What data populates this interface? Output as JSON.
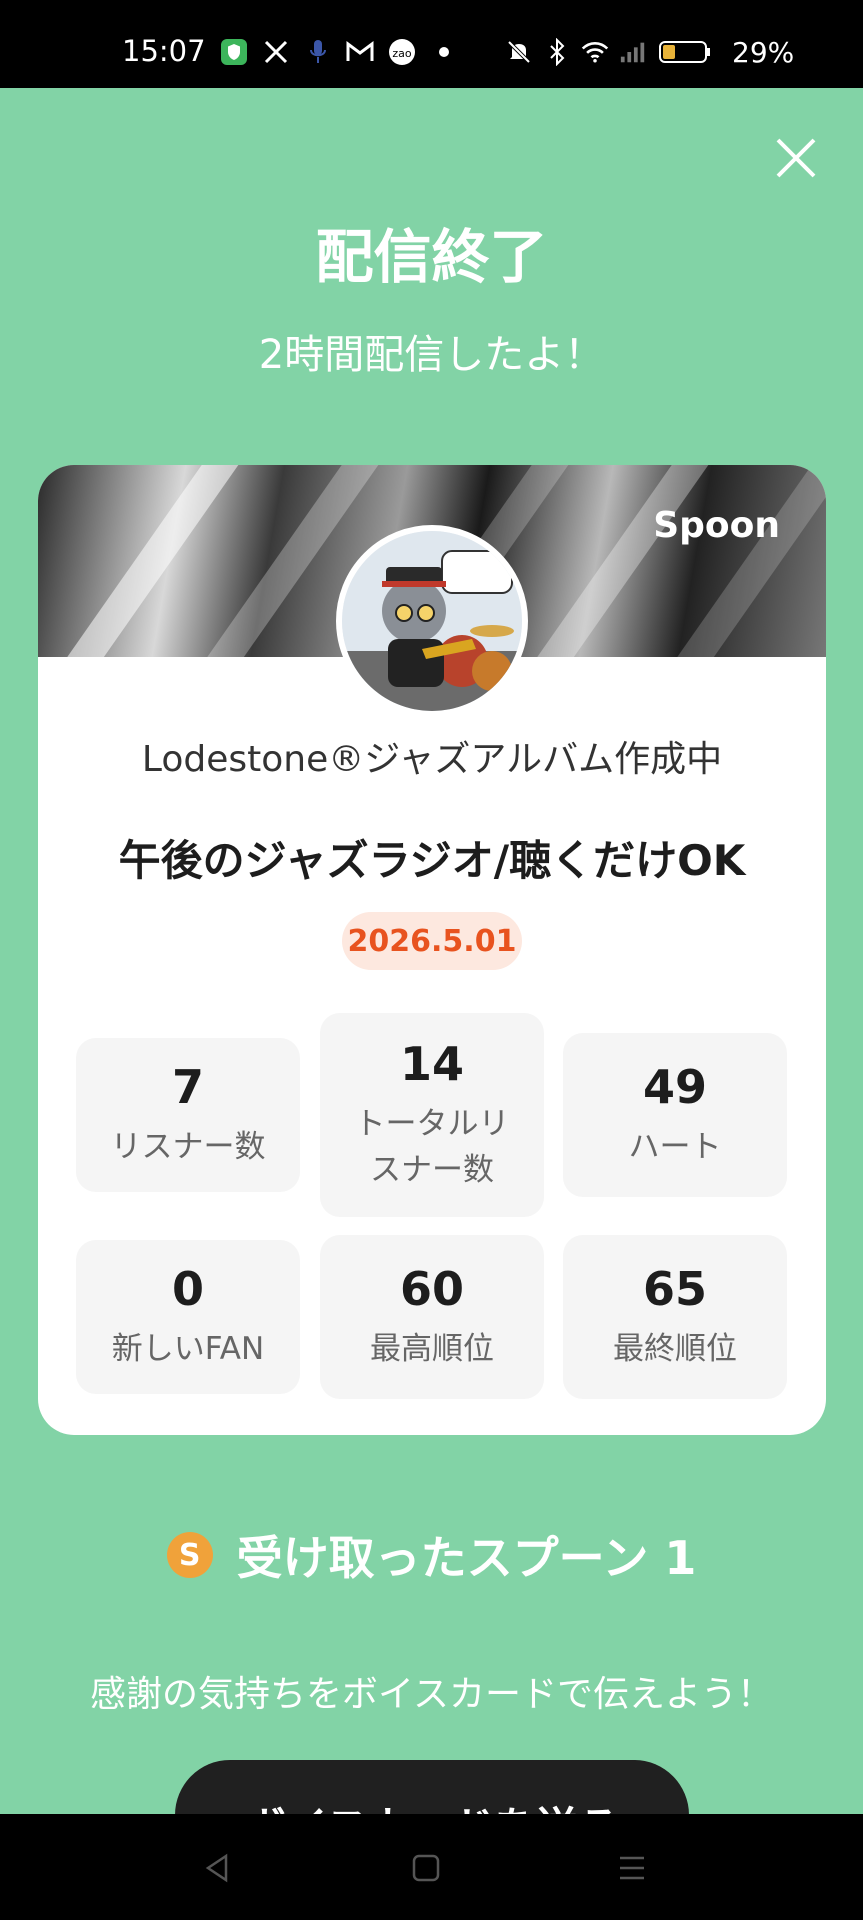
{
  "status_bar": {
    "time": "15:07",
    "battery_percent": "29%",
    "left_icons": [
      "shield-app-icon",
      "x-app-icon",
      "mic-icon",
      "gmail-icon",
      "app-badge-icon",
      "dot-icon"
    ],
    "right_icons": [
      "mute-icon",
      "bluetooth-icon",
      "wifi-icon",
      "signal-icon",
      "battery-icon"
    ]
  },
  "header": {
    "title": "配信終了",
    "subtitle": "2時間配信したよ！",
    "close_icon": "close-icon"
  },
  "card": {
    "brand": "Spoon",
    "username": "Lodestone®ジャズアルバム作成中",
    "live_title": "午後のジャズラジオ/聴くだけOK",
    "date": "2026.5.01",
    "stats": [
      {
        "value": "7",
        "label": "リスナー数"
      },
      {
        "value": "14",
        "label_line1": "トータルリ",
        "label_line2": "スナー数"
      },
      {
        "value": "49",
        "label": "ハート"
      },
      {
        "value": "0",
        "label": "新しいFAN"
      },
      {
        "value": "60",
        "label": "最高順位"
      },
      {
        "value": "65",
        "label": "最終順位"
      }
    ]
  },
  "spoons": {
    "coin_letter": "S",
    "text": "受け取ったスプーン 1"
  },
  "thanks_text": "感謝の気持ちをボイスカードで伝えよう！",
  "send_button_label": "ボイスカードを送る",
  "nav": [
    "back-icon",
    "home-icon",
    "menu-icon"
  ],
  "colors": {
    "background": "#82d3a6",
    "date_badge_bg": "#fde8df",
    "date_badge_text": "#e8531f",
    "button_bg": "#202020"
  }
}
